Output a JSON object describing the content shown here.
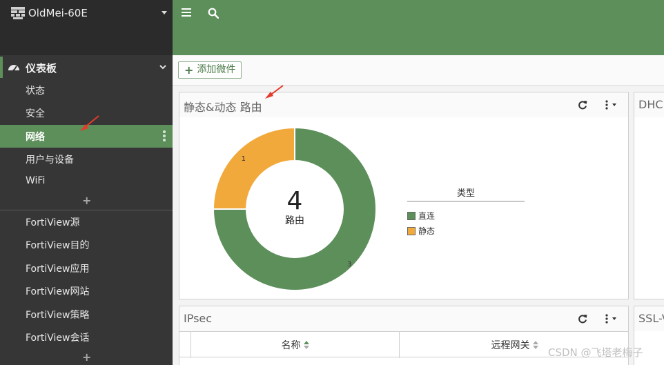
{
  "sidebar": {
    "device_name": "OldMei-60E",
    "section": {
      "label": "仪表板"
    },
    "dashboard_items": [
      {
        "label": "状态"
      },
      {
        "label": "安全"
      },
      {
        "label": "网络"
      },
      {
        "label": "用户与设备"
      },
      {
        "label": "WiFi"
      }
    ],
    "add_label": "+",
    "fortiview_items": [
      {
        "label": "FortiView源"
      },
      {
        "label": "FortiView目的"
      },
      {
        "label": "FortiView应用"
      },
      {
        "label": "FortiView网站"
      },
      {
        "label": "FortiView策略"
      },
      {
        "label": "FortiView会话"
      }
    ],
    "add_label_2": "+"
  },
  "toolbar": {
    "add_widget_label": "添加微件",
    "add_widget_icon": "plus-icon"
  },
  "routes_widget": {
    "title": "静态&动态 路由",
    "total": "4",
    "total_label": "路由",
    "legend_title": "类型",
    "colors": {
      "直连": "#5d8f5b",
      "静态": "#f2a93b"
    }
  },
  "chart_data": {
    "type": "pie",
    "title": "静态&动态 路由",
    "center_value": "4",
    "center_label": "路由",
    "legend_title": "类型",
    "legend_position": "right",
    "categories": [
      "直连",
      "静态"
    ],
    "values": [
      3,
      1
    ],
    "colors": [
      "#5d8f5b",
      "#f2a93b"
    ],
    "data_labels": [
      "3",
      "1"
    ]
  },
  "dhcp_widget": {
    "title": "DHC"
  },
  "ipsec_widget": {
    "title": "IPsec",
    "columns": [
      {
        "label": "名称"
      },
      {
        "label": "远程网关"
      }
    ]
  },
  "ssl_widget": {
    "title": "SSL-V"
  },
  "watermark": "CSDN @飞塔老梅子",
  "colors": {
    "accent": "#5d8f5b",
    "sidebar_bg": "#363636",
    "orange": "#f2a93b"
  }
}
